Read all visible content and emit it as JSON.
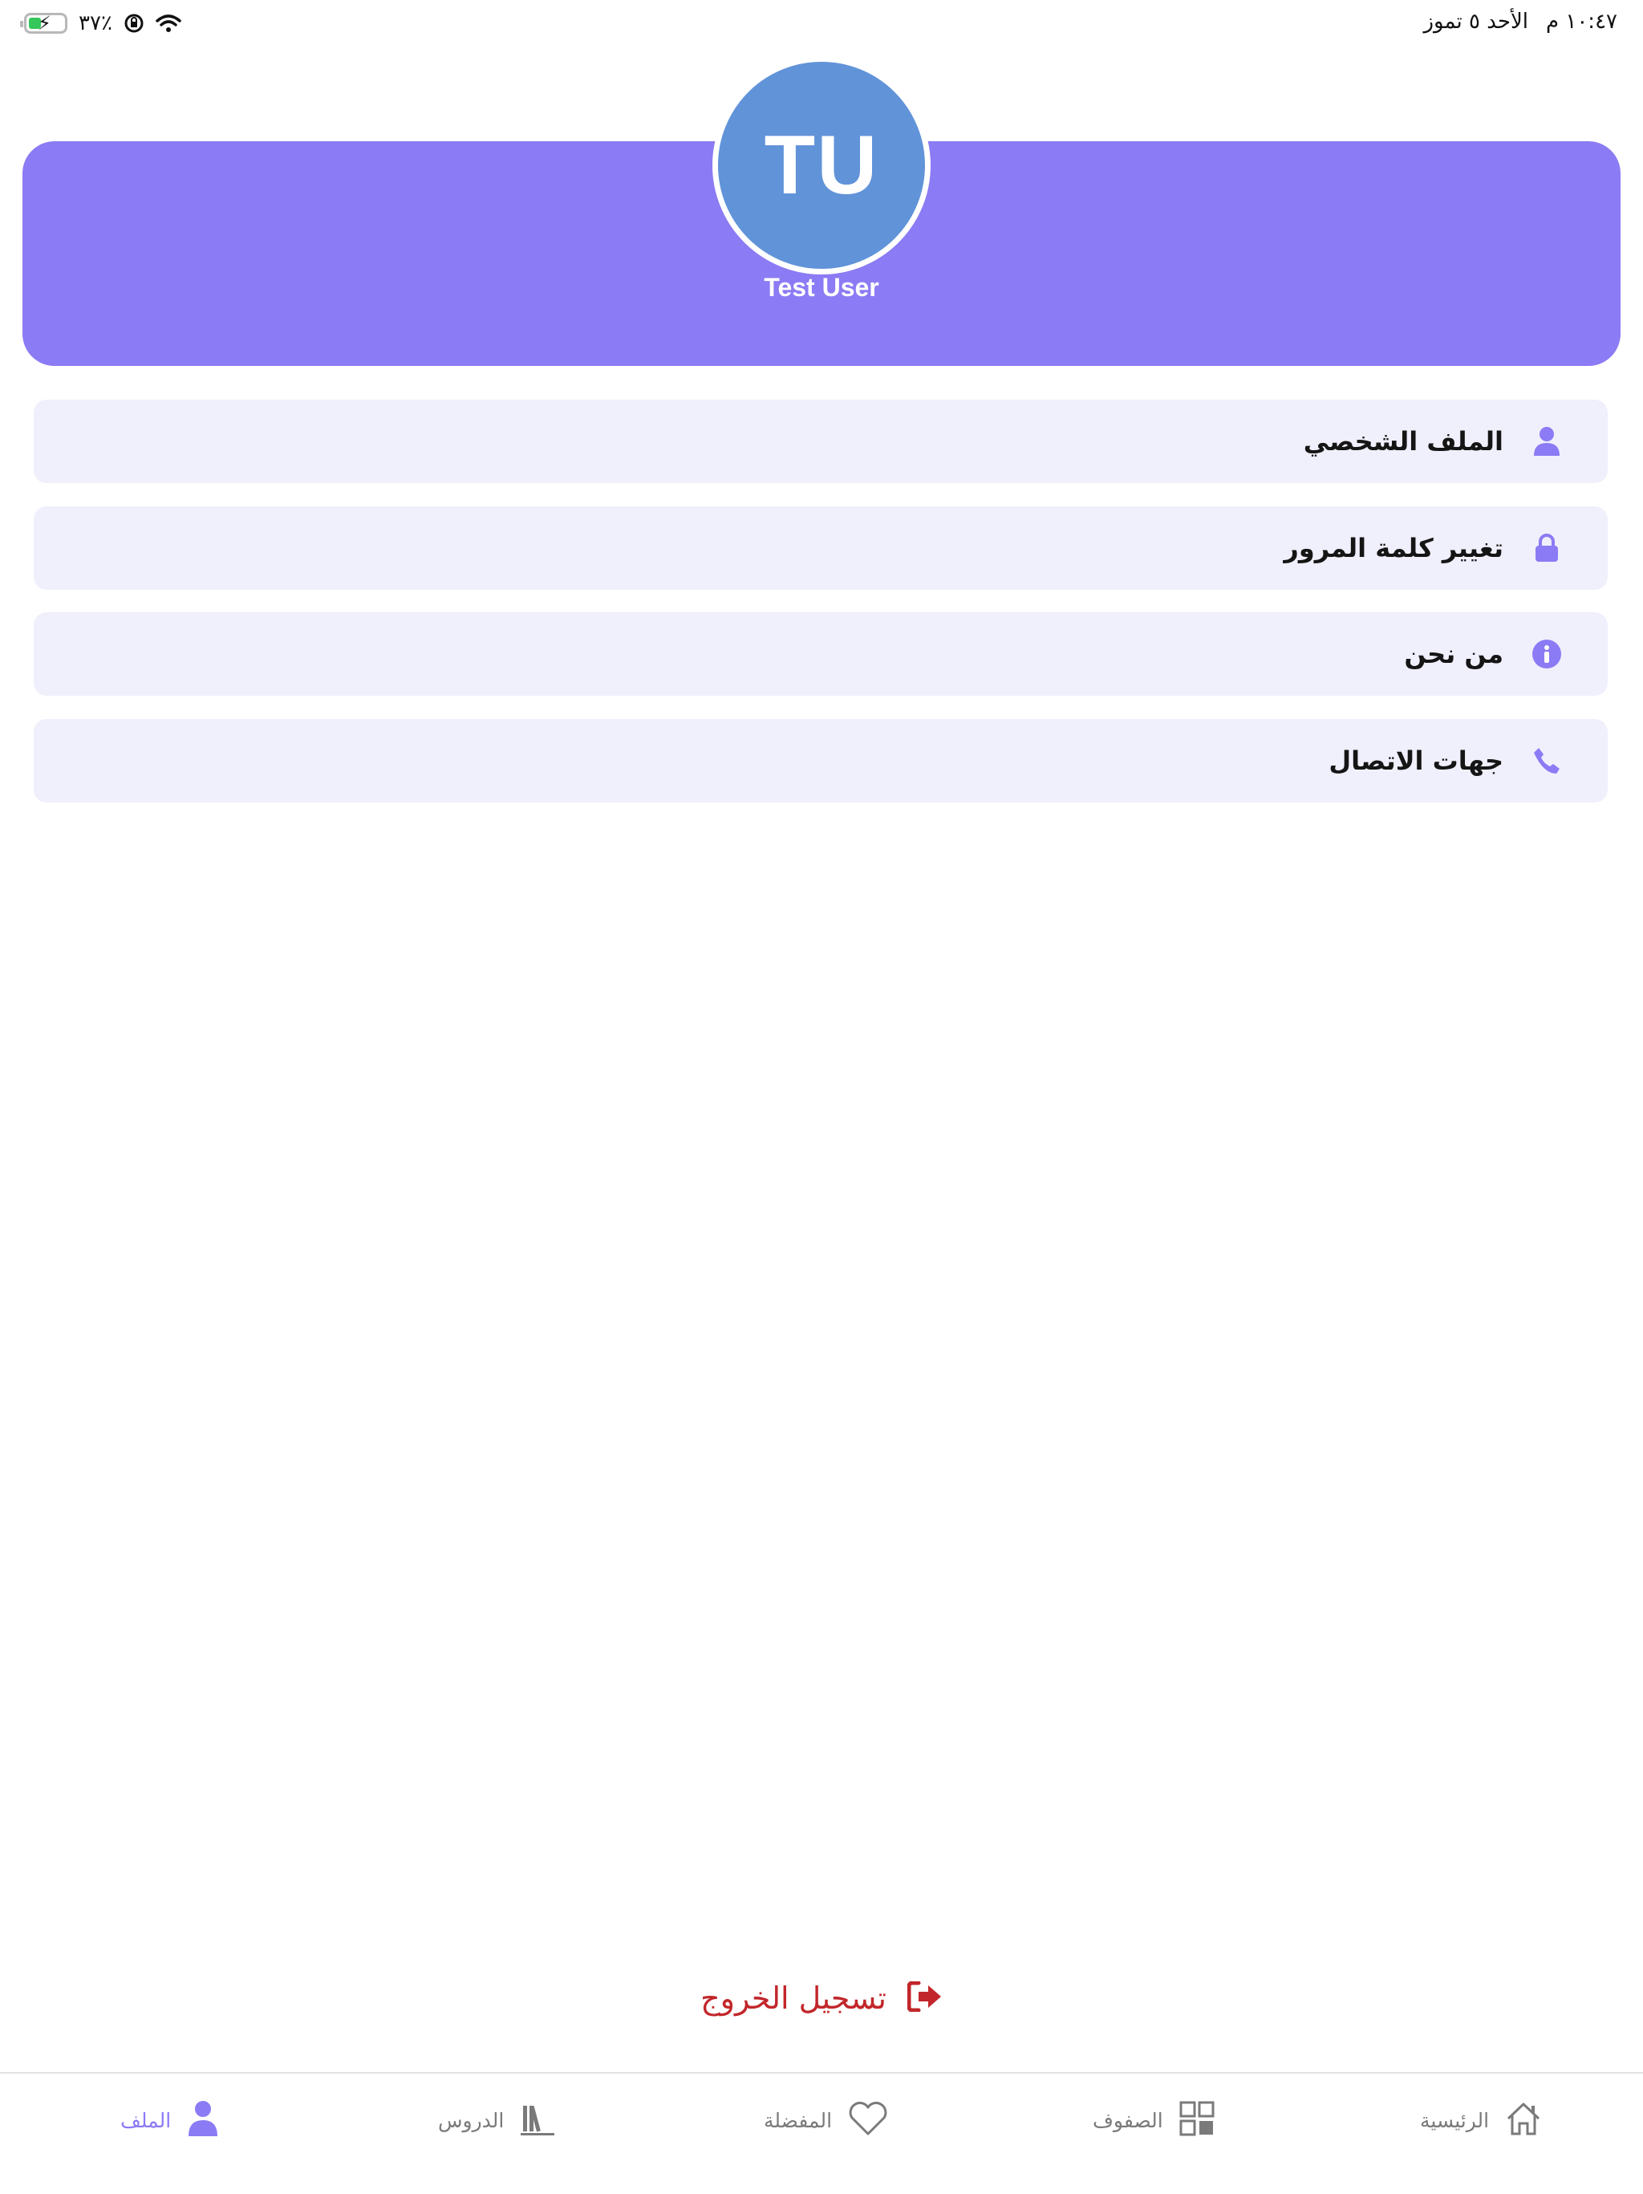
{
  "status_bar": {
    "time": "١٠:٤٧ م",
    "date": "الأحد ٥ تموز",
    "battery_percent": "٣٧٪",
    "battery_level": 0.37
  },
  "profile": {
    "initials": "TU",
    "name": "Test User"
  },
  "menu": {
    "items": [
      {
        "label": "الملف الشخصي",
        "icon": "user-icon"
      },
      {
        "label": "تغيير كلمة المرور",
        "icon": "lock-icon"
      },
      {
        "label": "من نحن",
        "icon": "info-icon"
      },
      {
        "label": "جهات الاتصال",
        "icon": "phone-icon"
      }
    ]
  },
  "logout": {
    "label": "تسجيل الخروج",
    "icon": "sign-out-icon"
  },
  "tabs": [
    {
      "label": "الرئيسية",
      "icon": "home-icon"
    },
    {
      "label": "الصفوف",
      "icon": "grid-icon"
    },
    {
      "label": "المفضلة",
      "icon": "heart-icon"
    },
    {
      "label": "الدروس",
      "icon": "books-icon"
    },
    {
      "label": "الملف",
      "icon": "user-icon",
      "active": true
    }
  ],
  "colors": {
    "accent": "#8b7bf4",
    "avatar": "#6193d9",
    "menu_bg": "#f0effc",
    "logout": "#c2262a",
    "tab_inactive": "#7a7a7a"
  }
}
